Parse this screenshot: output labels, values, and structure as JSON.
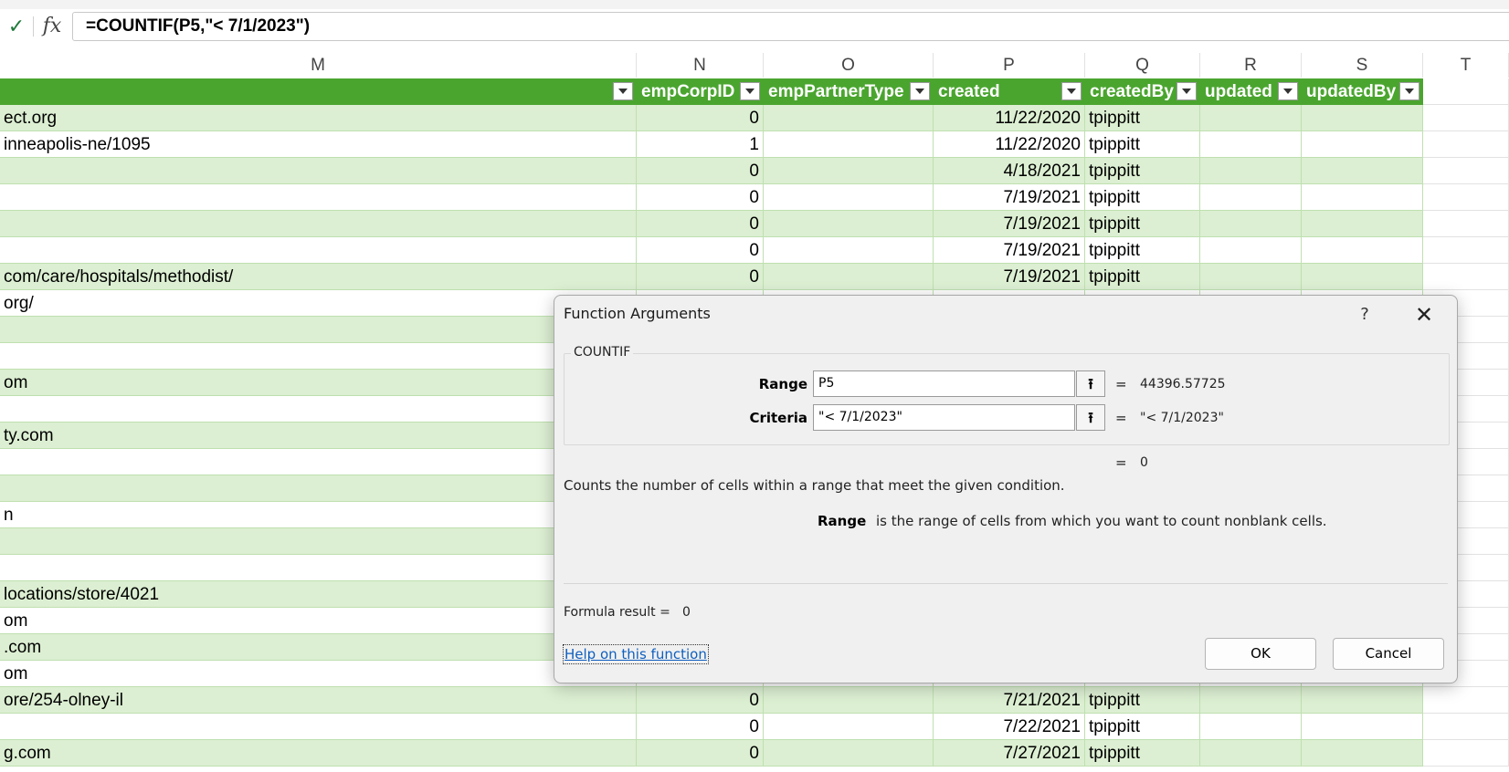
{
  "formula_bar": {
    "check_icon": "check-icon",
    "fx_label": "fx",
    "formula": "=COUNTIF(P5,\"< 7/1/2023\")"
  },
  "columns": [
    "M",
    "N",
    "O",
    "P",
    "Q",
    "R",
    "S",
    "T"
  ],
  "table_headers": {
    "N": "empCorpID",
    "O": "empPartnerType",
    "P": "created",
    "Q": "createdBy",
    "R": "updated",
    "S": "updatedBy"
  },
  "rows": [
    {
      "M": "ect.org",
      "N": "0",
      "P": "11/22/2020",
      "Q": "tpippitt"
    },
    {
      "M": "inneapolis-ne/1095",
      "N": "1",
      "P": "11/22/2020",
      "Q": "tpippitt"
    },
    {
      "M": "",
      "N": "0",
      "P": "4/18/2021",
      "Q": "tpippitt"
    },
    {
      "M": "",
      "N": "0",
      "P": "7/19/2021",
      "Q": "tpippitt"
    },
    {
      "M": "",
      "N": "0",
      "P": "7/19/2021",
      "Q": "tpippitt"
    },
    {
      "M": "",
      "N": "0",
      "P": "7/19/2021",
      "Q": "tpippitt"
    },
    {
      "M": "com/care/hospitals/methodist/",
      "N": "0",
      "P": "7/19/2021",
      "Q": "tpippitt"
    },
    {
      "M": "org/"
    },
    {
      "M": ""
    },
    {
      "M": ""
    },
    {
      "M": "om"
    },
    {
      "M": ""
    },
    {
      "M": "ty.com"
    },
    {
      "M": ""
    },
    {
      "M": ""
    },
    {
      "M": "n"
    },
    {
      "M": ""
    },
    {
      "M": ""
    },
    {
      "M": "locations/store/4021"
    },
    {
      "M": "om"
    },
    {
      "M": ".com"
    },
    {
      "M": "om"
    },
    {
      "M": "ore/254-olney-il",
      "N": "0",
      "P": "7/21/2021",
      "Q": "tpippitt"
    },
    {
      "M": "",
      "N": "0",
      "P": "7/22/2021",
      "Q": "tpippitt"
    },
    {
      "M": "g.com",
      "N": "0",
      "P": "7/27/2021",
      "Q": "tpippitt"
    }
  ],
  "dialog": {
    "title": "Function Arguments",
    "help_label": "?",
    "close_label": "✕",
    "function_name": "COUNTIF",
    "args": [
      {
        "label": "Range",
        "value": "P5",
        "eq": "=",
        "result": "44396.57725"
      },
      {
        "label": "Criteria",
        "value": "\"< 7/1/2023\"",
        "eq": "=",
        "result": "\"< 7/1/2023\""
      }
    ],
    "overall_eq": "=",
    "overall_result": "0",
    "description": "Counts the number of cells within a range that meet the given condition.",
    "arg_desc_name": "Range",
    "arg_desc_text": "is the range of cells from which you want to count nonblank cells.",
    "formula_result_label": "Formula result =",
    "formula_result_value": "0",
    "help_link": "Help on this function",
    "ok_label": "OK",
    "cancel_label": "Cancel"
  }
}
